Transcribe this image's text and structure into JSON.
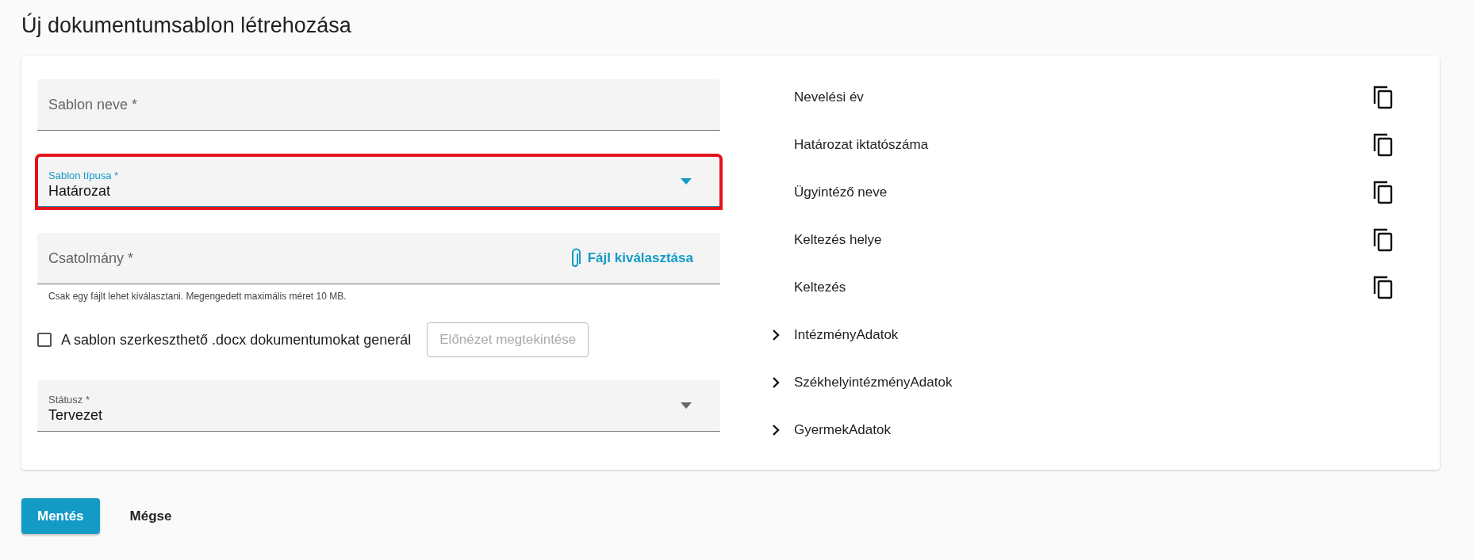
{
  "title": "Új dokumentumsablon létrehozása",
  "fields": [
    {
      "kind": "text",
      "placeholder": "Sablon neve *",
      "highlighted": false
    },
    {
      "kind": "select",
      "label": "Sablon típusa *",
      "value": "Határozat",
      "focused": true,
      "highlighted": true
    },
    {
      "kind": "file",
      "placeholder": "Csatolmány *",
      "action": "Fájl kiválasztása",
      "hint": "Csak egy fájlt lehet kiválasztani. Megengedett maximális méret 10 MB.",
      "highlighted": false
    },
    {
      "kind": "option_row",
      "checkbox": {
        "label": "A sablon szerkeszthető .docx dokumentumokat generál",
        "checked": false
      },
      "button": {
        "label": "Előnézet megtekintése",
        "disabled": true
      }
    },
    {
      "kind": "select",
      "label": "Státusz *",
      "value": "Tervezet",
      "focused": false,
      "highlighted": false
    }
  ],
  "placeholders": [
    {
      "kind": "leaf",
      "label": "Nevelési év"
    },
    {
      "kind": "leaf",
      "label": "Határozat iktatószáma"
    },
    {
      "kind": "leaf",
      "label": "Ügyintéző neve"
    },
    {
      "kind": "leaf",
      "label": "Keltezés helye"
    },
    {
      "kind": "leaf",
      "label": "Keltezés"
    },
    {
      "kind": "group",
      "label": "IntézményAdatok",
      "expanded": false
    },
    {
      "kind": "group",
      "label": "SzékhelyintézményAdatok",
      "expanded": false
    },
    {
      "kind": "group",
      "label": "GyermekAdatok",
      "expanded": false
    }
  ],
  "actions": [
    {
      "kind": "primary",
      "label": "Mentés"
    },
    {
      "kind": "text",
      "label": "Mégse"
    }
  ]
}
